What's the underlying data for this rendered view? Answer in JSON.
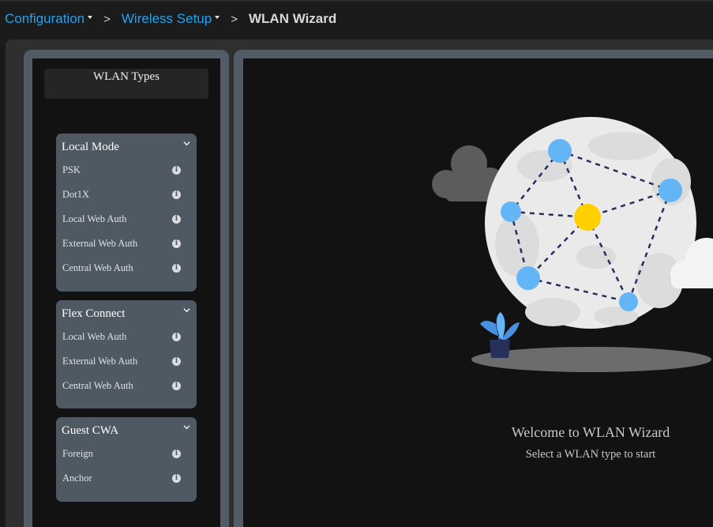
{
  "breadcrumb": {
    "items": [
      {
        "label": "Configuration"
      },
      {
        "label": "Wireless Setup"
      }
    ],
    "separator": ">",
    "current": "WLAN Wizard"
  },
  "sidebar": {
    "title": "WLAN Types",
    "groups": [
      {
        "title": "Local Mode",
        "items": [
          "PSK",
          "Dot1X",
          "Local Web Auth",
          "External Web Auth",
          "Central Web Auth"
        ]
      },
      {
        "title": "Flex Connect",
        "items": [
          "Local Web Auth",
          "External Web Auth",
          "Central Web Auth"
        ]
      },
      {
        "title": "Guest CWA",
        "items": [
          "Foreign",
          "Anchor"
        ]
      }
    ],
    "info_glyph": "i"
  },
  "main": {
    "welcome_title": "Welcome to WLAN Wizard",
    "welcome_subtitle": "Select a WLAN type to start"
  },
  "colors": {
    "link": "#1fa3f2",
    "panel_frame": "#535c66",
    "group_bg": "#4e5964",
    "node_blue": "#64b5f6",
    "node_center": "#ffd000"
  },
  "icons": [
    "chevron-down-icon",
    "info-icon",
    "network-globe-illustration"
  ]
}
